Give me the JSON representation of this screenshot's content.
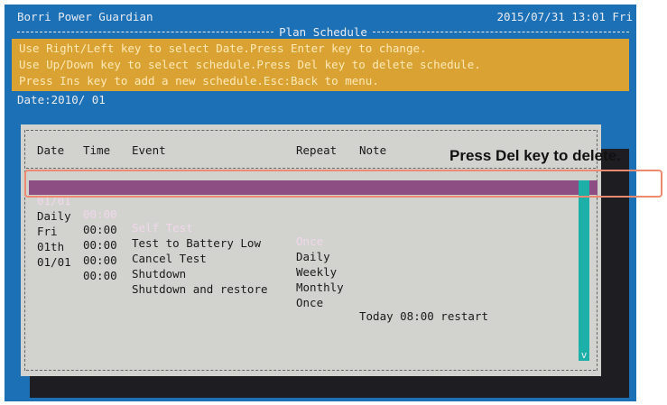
{
  "app": {
    "title": "Borri Power Guardian",
    "datetime": "2015/07/31 13:01 Fri"
  },
  "screen": {
    "title": "Plan Schedule"
  },
  "help_lines": [
    "Use Right/Left key to select Date.Press Enter key to change.",
    "Use Up/Down key to select schedule.Press Del key to delete schedule.",
    "Press Ins key to add a new schedule.Esc:Back to menu."
  ],
  "date_line": "Date:2010/ 01",
  "table": {
    "columns": [
      "Date",
      "Time",
      "Event",
      "Repeat",
      "Note"
    ],
    "rows": [
      {
        "date": "01/01",
        "time": "00:00",
        "event": "Self Test",
        "repeat": "Once",
        "note": ""
      },
      {
        "date": "Daily",
        "time": "00:00",
        "event": "Test to Battery Low",
        "repeat": "Daily",
        "note": ""
      },
      {
        "date": "Fri",
        "time": "00:00",
        "event": "Cancel Test",
        "repeat": "Weekly",
        "note": ""
      },
      {
        "date": "01th",
        "time": "00:00",
        "event": "Shutdown",
        "repeat": "Monthly",
        "note": ""
      },
      {
        "date": "01/01",
        "time": "00:00",
        "event": "Shutdown and restore",
        "repeat": "Once",
        "note": "Today 08:00 restart"
      }
    ],
    "selected_row": 0
  },
  "scroll": {
    "arrow_glyph": "v"
  },
  "callout": {
    "text": "Press Del key to delete."
  },
  "colors": {
    "screen_bg": "#1c70b6",
    "help_bg": "#d9a232",
    "panel_bg": "#d2d3cf",
    "selected_row_bg": "#8d4e84",
    "scrollbar": "#1cb0a8",
    "callout_border": "#ef8a72"
  }
}
